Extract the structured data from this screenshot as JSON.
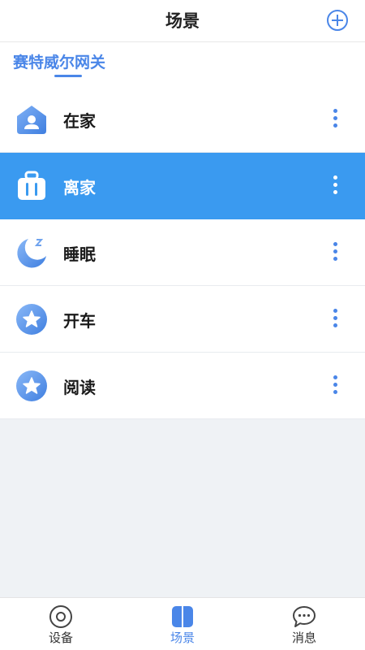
{
  "header": {
    "title": "场景",
    "add_icon": "plus-circle-icon"
  },
  "gateway_tab": {
    "label": "赛特威尔网关"
  },
  "scenes": [
    {
      "label": "在家",
      "icon": "home-icon",
      "active": false
    },
    {
      "label": "离家",
      "icon": "luggage-icon",
      "active": true
    },
    {
      "label": "睡眠",
      "icon": "moon-icon",
      "active": false
    },
    {
      "label": "开车",
      "icon": "star-icon",
      "active": false
    },
    {
      "label": "阅读",
      "icon": "star-icon",
      "active": false
    }
  ],
  "bottom_nav": [
    {
      "label": "设备",
      "icon": "device-icon",
      "active": false
    },
    {
      "label": "场景",
      "icon": "scene-icon",
      "active": true
    },
    {
      "label": "消息",
      "icon": "chat-icon",
      "active": false
    }
  ],
  "colors": {
    "accent": "#4a86e8",
    "active_row": "#3a9af0"
  }
}
